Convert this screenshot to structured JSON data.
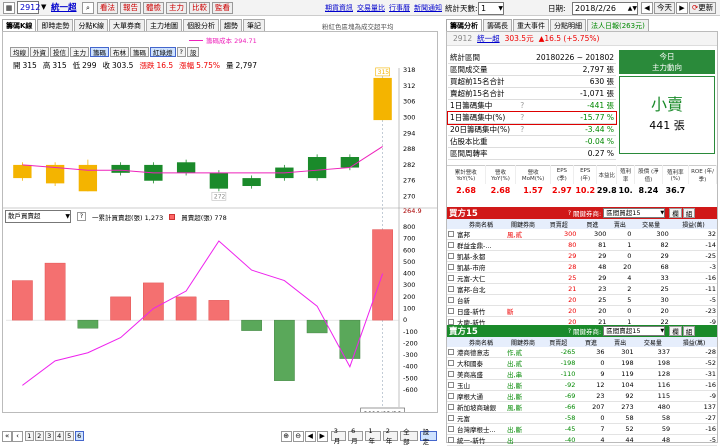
{
  "topbar": {
    "stock_code": "2912",
    "stock_name": "統一超",
    "tools": [
      "看法",
      "報告",
      "體檢",
      "主力",
      "比較",
      "監看"
    ],
    "links": [
      "期貨資訊",
      "交易量比",
      "行事曆",
      "新聞通知"
    ],
    "period_label": "統計天數:",
    "period_value": "1",
    "date_label": "日期:",
    "date_value": "2018/2/26",
    "today_btn": "今天",
    "refresh_btn": "更新"
  },
  "left_tabs": [
    "籌碼K線",
    "即時走勢",
    "分點K線",
    "大單券商",
    "主力地圖",
    "個股分析",
    "趨勢",
    "筆記"
  ],
  "chart_hint": "粉紅色區塊為成交超平均",
  "legend_line": "籌碼成本 294.71",
  "chart_buttons": [
    "均線",
    "外資",
    "投信",
    "主力",
    "籌碼",
    "布林",
    "籌碼",
    "紅綠燈",
    "?",
    "設"
  ],
  "ohlc": {
    "open_l": "開",
    "open": "315",
    "high_l": "高",
    "high": "315",
    "low_l": "低",
    "low": "299",
    "close_l": "收",
    "close": "303.5",
    "chg_l": "漲跌",
    "chg": "16.5",
    "pct_l": "漲幅",
    "pct": "5.75%",
    "vol_l": "量",
    "vol": "2,797"
  },
  "panel2": {
    "select": "散戶買賣超",
    "legend_a": "一累計買賣超(張) 1,273",
    "legend_b": "買賣超(張) 778"
  },
  "price_axis": [
    "318",
    "312",
    "306",
    "300",
    "294",
    "288",
    "282",
    "276",
    "270",
    "264.9"
  ],
  "vol_axis": [
    "800",
    "700",
    "600",
    "500",
    "400",
    "300",
    "200",
    "100",
    "0",
    "-100",
    "-200",
    "-300",
    "-400",
    "-500",
    "-600"
  ],
  "price_tags": {
    "top": "315",
    "low": "272"
  },
  "date_left": "2/05",
  "date_left_year": "2018",
  "date_cursor": "2018/02/26",
  "bottom_nums": [
    "1",
    "2",
    "3",
    "4",
    "5",
    "6"
  ],
  "bottom_btns": [
    "3月",
    "6月",
    "1年",
    "2年",
    "全部",
    "設定"
  ],
  "right_tabs": [
    "籌碼分析",
    "籌碼長",
    "重大事件",
    "分點明細",
    "法人日報(263元)"
  ],
  "quote": {
    "code": "2912",
    "name": "統一超",
    "price": "303.5元",
    "chg": "▲16.5 (+5.75%)"
  },
  "stats": [
    {
      "k": "統計區間",
      "v": "20180226 ~ 201802"
    },
    {
      "k": "區間成交量",
      "v": "2,797 張"
    },
    {
      "k": "買超前15名合計",
      "v": "630 張"
    },
    {
      "k": "賣超前15名合計",
      "v": "-1,071 張"
    },
    {
      "k": "1日籌碼集中",
      "v": "-441 張"
    },
    {
      "k": "1日籌碼集中(%)",
      "v": "-15.77 %"
    },
    {
      "k": "20日籌碼集中(%)",
      "v": "-3.44 %"
    },
    {
      "k": "佔股本比重",
      "v": "-0.04 %"
    },
    {
      "k": "區間周轉率",
      "v": "0.27 %"
    }
  ],
  "today_box": {
    "t1": "今日",
    "t2": "主力動向",
    "t3": "小賣",
    "t4": "441 張"
  },
  "fund": {
    "heads": [
      "累計營收 YoY(%)",
      "營收 YoY(%)",
      "營收 MoM(%)",
      "EPS (季)",
      "EPS (年)",
      "本益比",
      "殖利率",
      "股價 (淨值)",
      "殖利率(%)",
      "ROE (年/季)"
    ],
    "vals": [
      "2.68",
      "2.68",
      "1.57",
      "2.97",
      "10.2",
      "29.8",
      "10.",
      "8.24",
      "36.7",
      ""
    ]
  },
  "buy": {
    "title": "買方15",
    "filter_label": "關鍵券商:",
    "filter_value": "區間買超15",
    "btn1": "欄",
    "btn2": "組",
    "heads": [
      "券商名稱",
      "關鍵券商",
      "買賣超",
      "買進",
      "賣出",
      "交易量",
      "損益(萬)"
    ],
    "rows": [
      [
        "富邦",
        "風,貳",
        "300",
        "300",
        "0",
        "300",
        "32"
      ],
      [
        "群益金鼎-...",
        "",
        "80",
        "81",
        "1",
        "82",
        "-14"
      ],
      [
        "凱基-永都",
        "",
        "29",
        "29",
        "0",
        "29",
        "-25"
      ],
      [
        "凱基-市府",
        "",
        "28",
        "48",
        "20",
        "68",
        "-3"
      ],
      [
        "元富-大仁",
        "",
        "25",
        "29",
        "4",
        "33",
        "-16"
      ],
      [
        "富邦-台北",
        "",
        "21",
        "23",
        "2",
        "25",
        "-11"
      ],
      [
        "台新",
        "",
        "20",
        "25",
        "5",
        "30",
        "-5"
      ],
      [
        "日盛-新竹",
        "斷",
        "20",
        "20",
        "0",
        "20",
        "-23"
      ],
      [
        "大慶-新竹",
        "",
        "20",
        "21",
        "1",
        "22",
        "-9"
      ]
    ]
  },
  "sell": {
    "title": "賣方15",
    "filter_label": "關鍵券商:",
    "filter_value": "區間賣超15",
    "btn1": "欄",
    "btn2": "組",
    "heads": [
      "券商名稱",
      "關鍵券商",
      "買賣超",
      "買進",
      "賣出",
      "交易量",
      "損益(萬)"
    ],
    "rows": [
      [
        "港商德意志",
        "作,貳",
        "-265",
        "36",
        "301",
        "337",
        "-28"
      ],
      [
        "大和國泰",
        "出,貳",
        "-198",
        "0",
        "198",
        "198",
        "-52"
      ],
      [
        "美商高盛",
        "出,串",
        "-110",
        "9",
        "119",
        "128",
        "-31"
      ],
      [
        "玉山",
        "出,斷",
        "-92",
        "12",
        "104",
        "116",
        "-16"
      ],
      [
        "摩根大通",
        "出,斷",
        "-69",
        "23",
        "92",
        "115",
        "-9"
      ],
      [
        "新加坡商瑞銀",
        "風,斷",
        "-66",
        "207",
        "273",
        "480",
        "137"
      ],
      [
        "元富",
        "",
        "-58",
        "0",
        "58",
        "58",
        "-27"
      ],
      [
        "台灣摩根士...",
        "出,斷",
        "-45",
        "7",
        "52",
        "59",
        "-16"
      ],
      [
        "統一-新竹",
        "出",
        "-40",
        "4",
        "44",
        "48",
        "-5"
      ]
    ]
  },
  "chart_data": {
    "type": "candlestick+bar",
    "price_ylim": [
      264.9,
      318
    ],
    "volume_ylim": [
      -600,
      800
    ],
    "candles": [
      {
        "o": 282,
        "c": 277,
        "h": 283,
        "l": 276
      },
      {
        "o": 282,
        "c": 275,
        "h": 283,
        "l": 274
      },
      {
        "o": 272,
        "c": 282,
        "h": 284,
        "l": 272
      },
      {
        "o": 282,
        "c": 279,
        "h": 283,
        "l": 278
      },
      {
        "o": 282,
        "c": 276,
        "h": 283,
        "l": 275
      },
      {
        "o": 279,
        "c": 283,
        "h": 284,
        "l": 278
      },
      {
        "o": 279,
        "c": 273,
        "h": 280,
        "l": 272
      },
      {
        "o": 277,
        "c": 274,
        "h": 278,
        "l": 273
      },
      {
        "o": 281,
        "c": 277,
        "h": 282,
        "l": 276
      },
      {
        "o": 285,
        "c": 277,
        "h": 286,
        "l": 276
      },
      {
        "o": 281,
        "c": 285,
        "h": 286,
        "l": 280
      },
      {
        "o": 299,
        "c": 315,
        "h": 315,
        "l": 299
      }
    ],
    "cost_line": [
      282,
      281,
      280,
      280,
      279,
      279,
      279,
      279,
      279,
      280,
      281,
      289
    ],
    "volume_bars": [
      340,
      490,
      -70,
      200,
      320,
      200,
      170,
      -90,
      -520,
      -110,
      -330,
      778
    ],
    "cumulative_line": [
      -560,
      -350,
      -280,
      -150,
      100,
      250,
      680,
      430,
      340,
      120,
      -400,
      400
    ]
  }
}
